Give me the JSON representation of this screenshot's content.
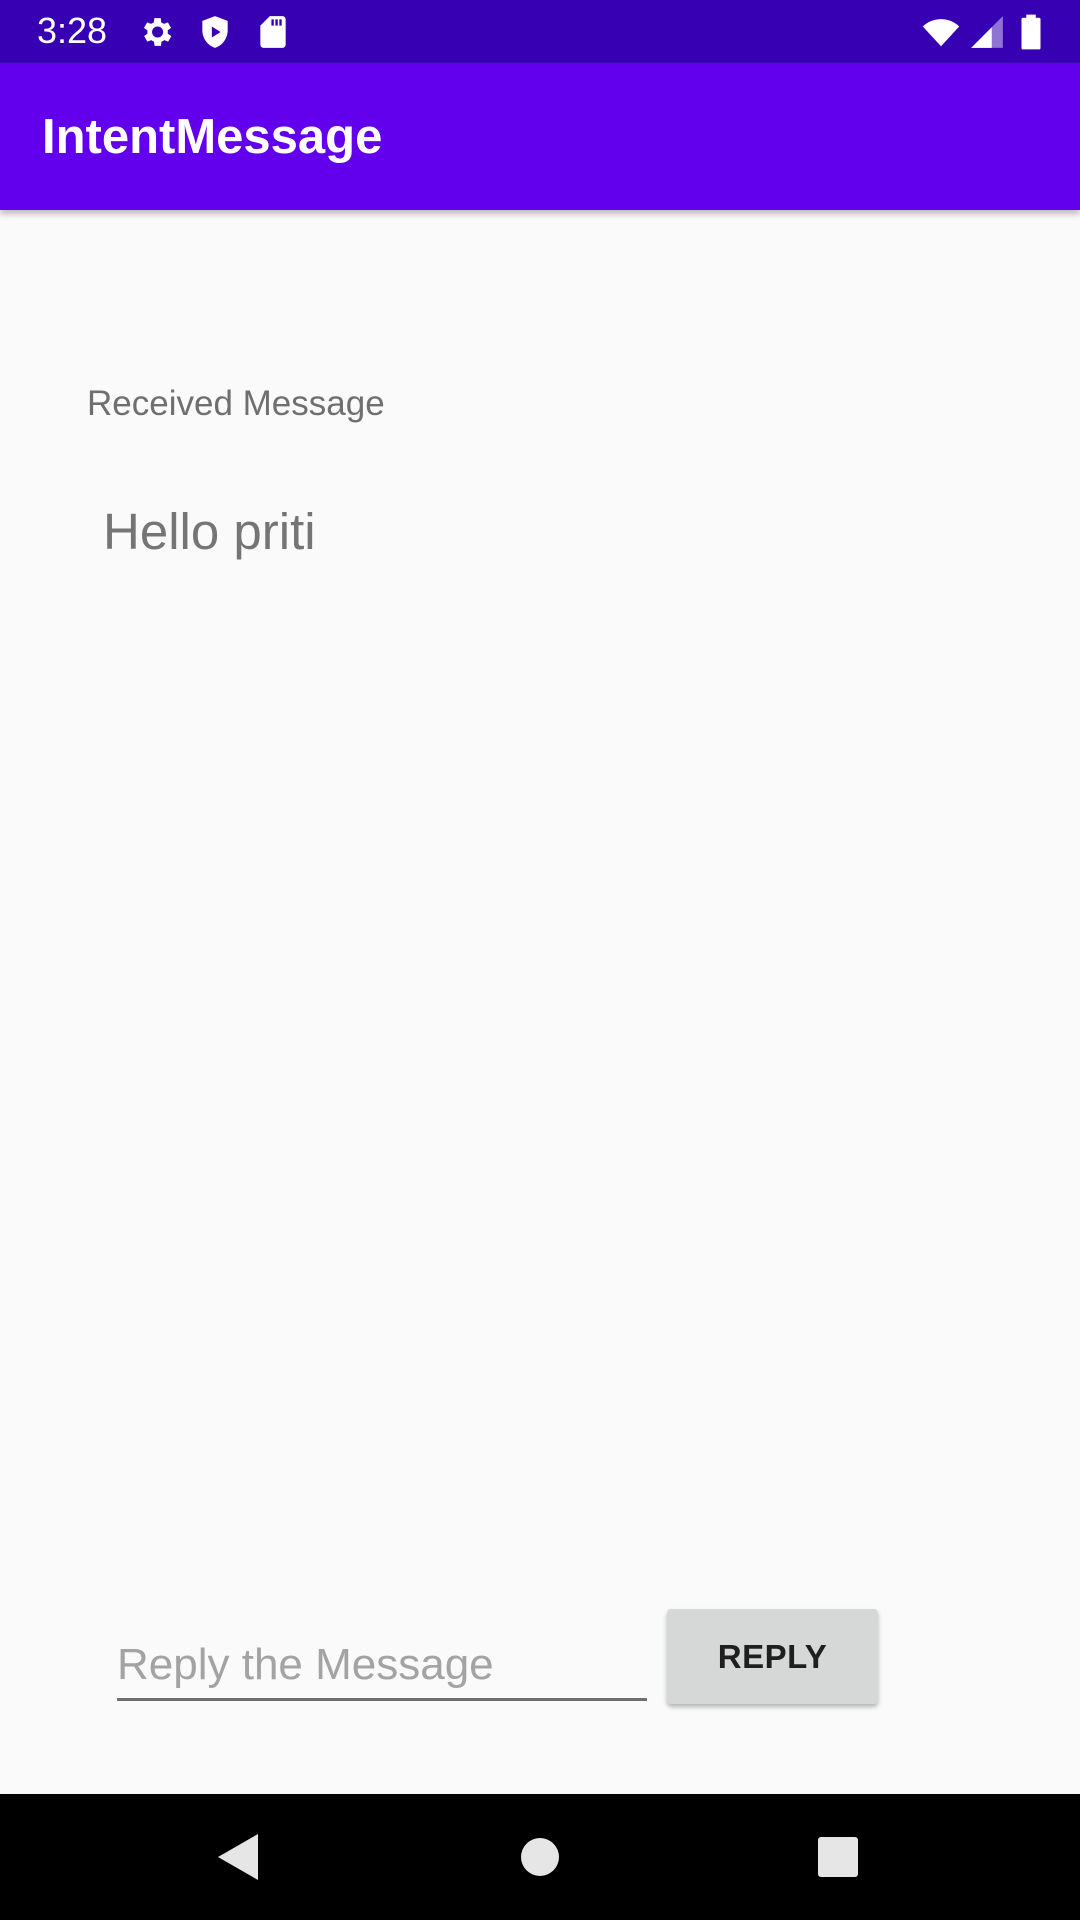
{
  "status_bar": {
    "time": "3:28",
    "icons": [
      "settings-icon",
      "shield-play-icon",
      "sd-card-icon",
      "wifi-icon",
      "cellular-signal-icon",
      "battery-icon"
    ]
  },
  "app_bar": {
    "title": "IntentMessage"
  },
  "main": {
    "received_label": "Received Message",
    "received_text": "Hello priti",
    "reply_placeholder": "Reply the Message",
    "reply_value": "",
    "reply_button_label": "REPLY"
  },
  "nav_bar": {
    "icons": [
      "back-icon",
      "home-icon",
      "recents-icon"
    ]
  },
  "colors": {
    "status_bar": "#3700b3",
    "app_bar": "#6200ee",
    "background": "#fafafa",
    "button": "#d6d7d7"
  }
}
